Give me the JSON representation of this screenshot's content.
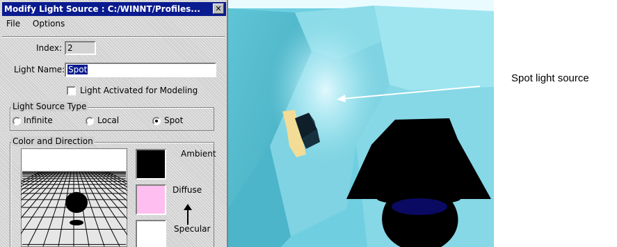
{
  "dialog": {
    "title": "Modify Light Source : C:/WINNT/Profiles...",
    "close_glyph": "✕",
    "menu": [
      "File",
      "Options"
    ],
    "index_label": "Index:",
    "index_value": "2",
    "light_name_label": "Light Name:",
    "light_name_value": "Spot",
    "activated_label": "Light Activated for Modeling",
    "activated_checked": false,
    "type_group": {
      "title": "Light Source Type",
      "options": [
        "Infinite",
        "Local",
        "Spot"
      ],
      "selected": "Spot"
    },
    "color_group": {
      "title": "Color and Direction",
      "swatches": [
        {
          "label": "Ambient",
          "color": "#000000"
        },
        {
          "label": "Diffuse",
          "color": "#ffbef0"
        },
        {
          "label": "Specular",
          "color": "#ffffff"
        }
      ]
    }
  },
  "annotation": {
    "text": "Spot light source"
  },
  "colors": {
    "title_bar": "#0a1b8f",
    "wall": "#7fd6e4",
    "lamp": "#000000",
    "lamp_base": "#0a0a7a"
  }
}
